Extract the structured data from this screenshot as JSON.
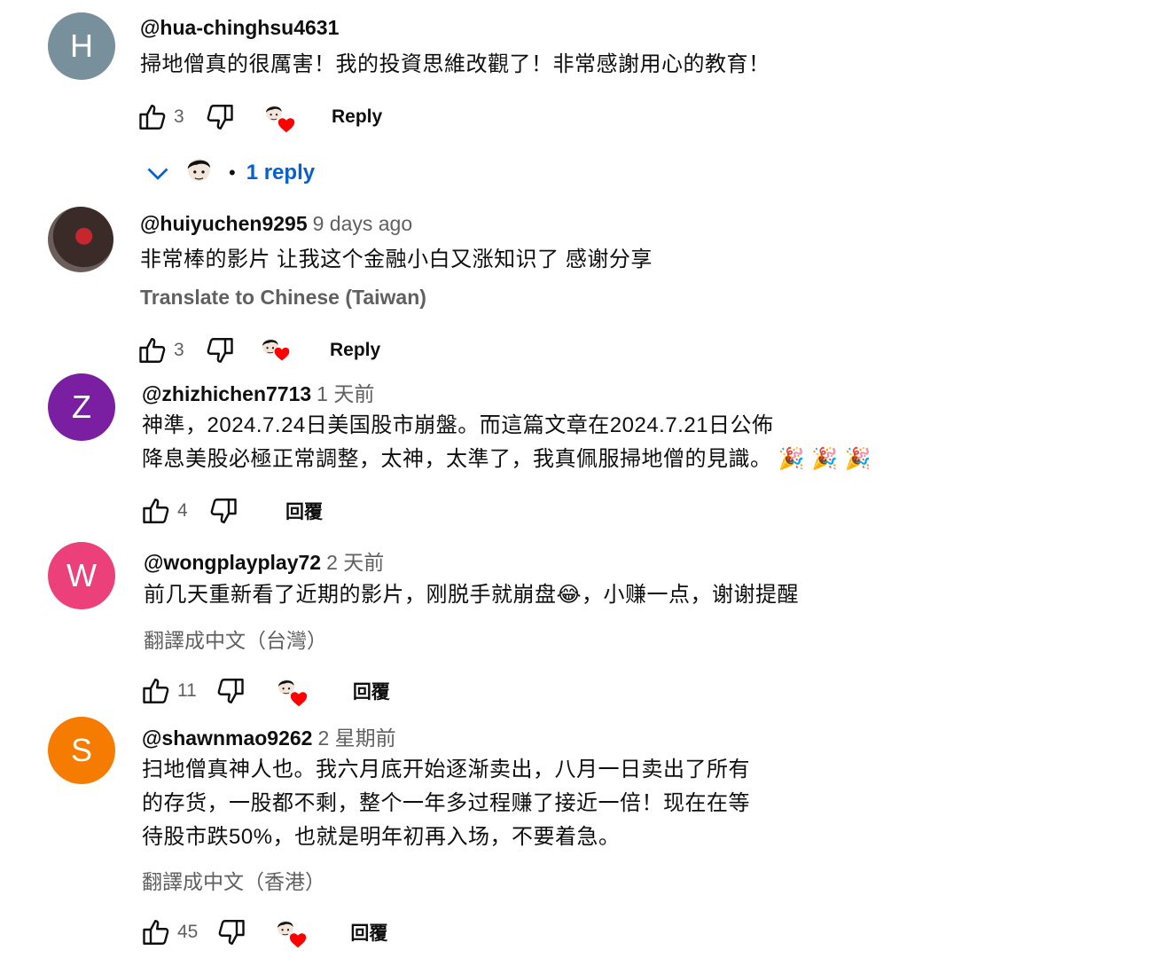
{
  "comments": [
    {
      "avatar_letter": "H",
      "avatar_color": "#78909c",
      "author": "@hua-chinghsu4631",
      "time": "",
      "text": "掃地僧真的很厲害！我的投資思維改觀了！非常感謝用心的教育！",
      "translate": "",
      "likes": "3",
      "reply_label": "Reply",
      "replies_label": "1 reply"
    },
    {
      "avatar_letter": "",
      "avatar_color": "#3a2a28",
      "author": "@huiyuchen9295",
      "time": "9 days ago",
      "text": "非常棒的影片 让我这个金融小白又涨知识了 感谢分享",
      "translate": "Translate to Chinese (Taiwan)",
      "likes": "3",
      "reply_label": "Reply"
    },
    {
      "avatar_letter": "Z",
      "avatar_color": "#7b1fa2",
      "author": "@zhizhichen7713",
      "time": "1 天前",
      "text_line1": "神準，2024.7.24日美国股市崩盤。而這篇文章在2024.7.21日公佈",
      "text_line2": "降息美股必極正常調整，太神，太準了，我真佩服掃地僧的見識。",
      "emoji": "🎉 🎉 🎉",
      "likes": "4",
      "reply_label": "回覆"
    },
    {
      "avatar_letter": "W",
      "avatar_color": "#ec407a",
      "author": "@wongplayplay72",
      "time": "2 天前",
      "text_before": "前几天重新看了近期的影片，刚脱手就崩盘",
      "emoji": "😂",
      "text_after": "，小赚一点，谢谢提醒",
      "translate": "翻譯成中文（台灣）",
      "likes": "11",
      "reply_label": "回覆"
    },
    {
      "avatar_letter": "S",
      "avatar_color": "#f57c00",
      "author": "@shawnmao9262",
      "time": "2 星期前",
      "text_line1": "扫地僧真神人也。我六月底开始逐渐卖出，八月一日卖出了所有",
      "text_line2": "的存货，一股都不剩，整个一年多过程赚了接近一倍！现在在等",
      "text_line3": "待股市跌50%，也就是明年初再入场，不要着急。",
      "translate": "翻譯成中文（香港）",
      "likes": "45",
      "reply_label": "回覆"
    }
  ],
  "icons": {
    "like": "thumb-up-icon",
    "dislike": "thumb-down-icon",
    "creator_heart": "creator-heart-avatar",
    "chevron": "chevron-down-icon"
  },
  "colors": {
    "link_blue": "#065fd4",
    "secondary_text": "#606060",
    "heart_red": "#ff0000"
  }
}
